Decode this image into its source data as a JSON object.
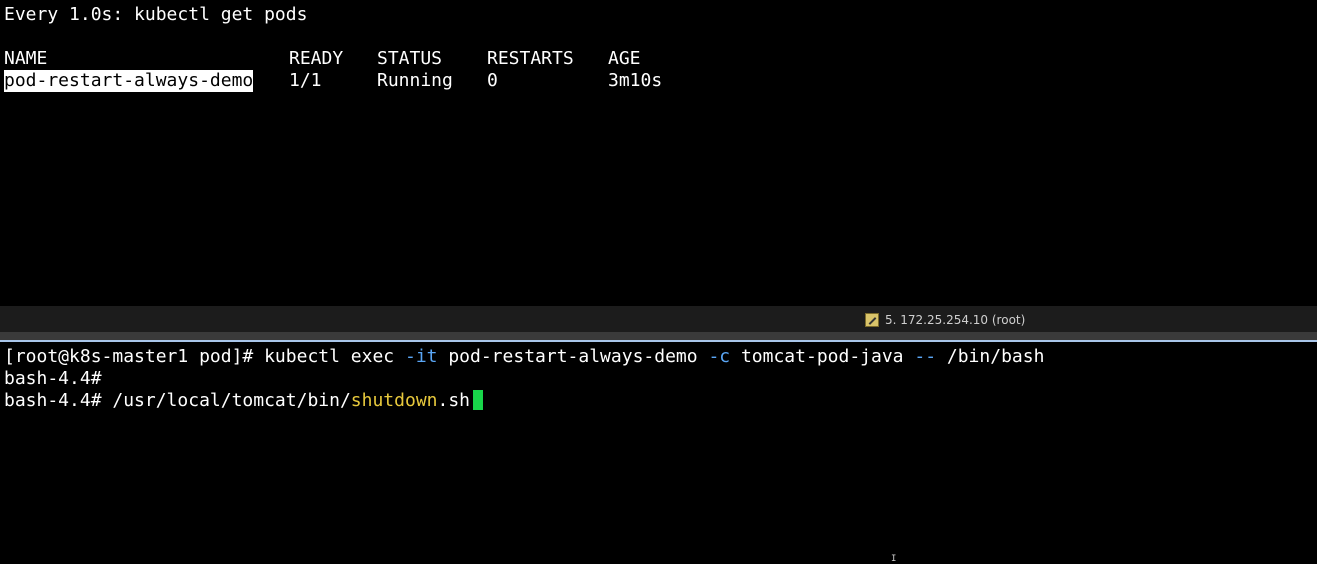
{
  "top_terminal": {
    "watch_header": "Every 1.0s: kubectl get pods",
    "columns": [
      "NAME",
      "READY",
      "STATUS",
      "RESTARTS",
      "AGE"
    ],
    "rows": [
      {
        "name": "pod-restart-always-demo",
        "ready": "1/1",
        "status": "Running",
        "restarts": "0",
        "age": "3m10s"
      }
    ]
  },
  "status_bar": {
    "tab_icon": "pencil-icon",
    "tab_label": "5. 172.25.254.10 (root)"
  },
  "bottom_terminal": {
    "line1": {
      "prompt": "[root@k8s-master1 pod]# ",
      "cmd_a": "kubectl exec ",
      "opt_it": "-it",
      "cmd_b": " pod-restart-always-demo ",
      "opt_c": "-c",
      "cmd_c": " tomcat-pod-java ",
      "opt_dd": "--",
      "cmd_d": " /bin/bash"
    },
    "line2": {
      "prompt": "bash-4.4#"
    },
    "line3": {
      "prompt": "bash-4.4# ",
      "path": "/usr/local/tomcat/bin/",
      "script_name": "shutdown",
      "script_ext": ".sh"
    }
  },
  "colors": {
    "option_blue": "#5aa6f5",
    "script_yellow": "#e8c93c",
    "cursor_green": "#18d64a",
    "divider_blue": "#a9c6ea"
  }
}
